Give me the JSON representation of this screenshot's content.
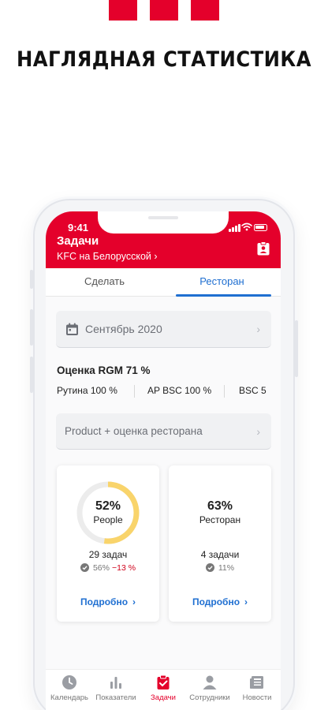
{
  "promo": {
    "title": "НАГЛЯДНАЯ СТАТИСТИКА",
    "brand_color": "#e4002b"
  },
  "status_bar": {
    "time": "9:41"
  },
  "header": {
    "title": "Задачи",
    "subtitle": "KFC на Белорусской ›",
    "action_icon": "clipboard-user-icon"
  },
  "tabs": [
    {
      "label": "Сделать",
      "active": false
    },
    {
      "label": "Ресторан",
      "active": true
    }
  ],
  "period": {
    "icon": "calendar-icon",
    "value": "Сентябрь 2020"
  },
  "rgm": {
    "title": "Оценка RGM  71 %",
    "items": [
      "Рутина 100 %",
      "AP BSC 100 %",
      "BSC 5"
    ]
  },
  "filter": {
    "value": "Product + оценка ресторана"
  },
  "cards": [
    {
      "percent": "52%",
      "percent_value": 0.52,
      "label": "People",
      "tasks": "29 задач",
      "done": "56%",
      "delta": "−13 %",
      "link": "Подробно"
    },
    {
      "percent": "63%",
      "label": "Ресторан",
      "tasks": "4 задачи",
      "done": "11%",
      "link": "Подробно"
    }
  ],
  "colors": {
    "accent": "#e4002b",
    "link": "#1f6fd1",
    "progress": "#f9d46b",
    "track": "#ececec",
    "negative": "#d0021b"
  },
  "bottom_nav": [
    {
      "label": "Календарь",
      "icon": "clock-icon",
      "active": false
    },
    {
      "label": "Показатели",
      "icon": "bar-chart-icon",
      "active": false
    },
    {
      "label": "Задачи",
      "icon": "clipboard-check-icon",
      "active": true
    },
    {
      "label": "Сотрудники",
      "icon": "person-icon",
      "active": false
    },
    {
      "label": "Новости",
      "icon": "newspaper-icon",
      "active": false
    }
  ]
}
